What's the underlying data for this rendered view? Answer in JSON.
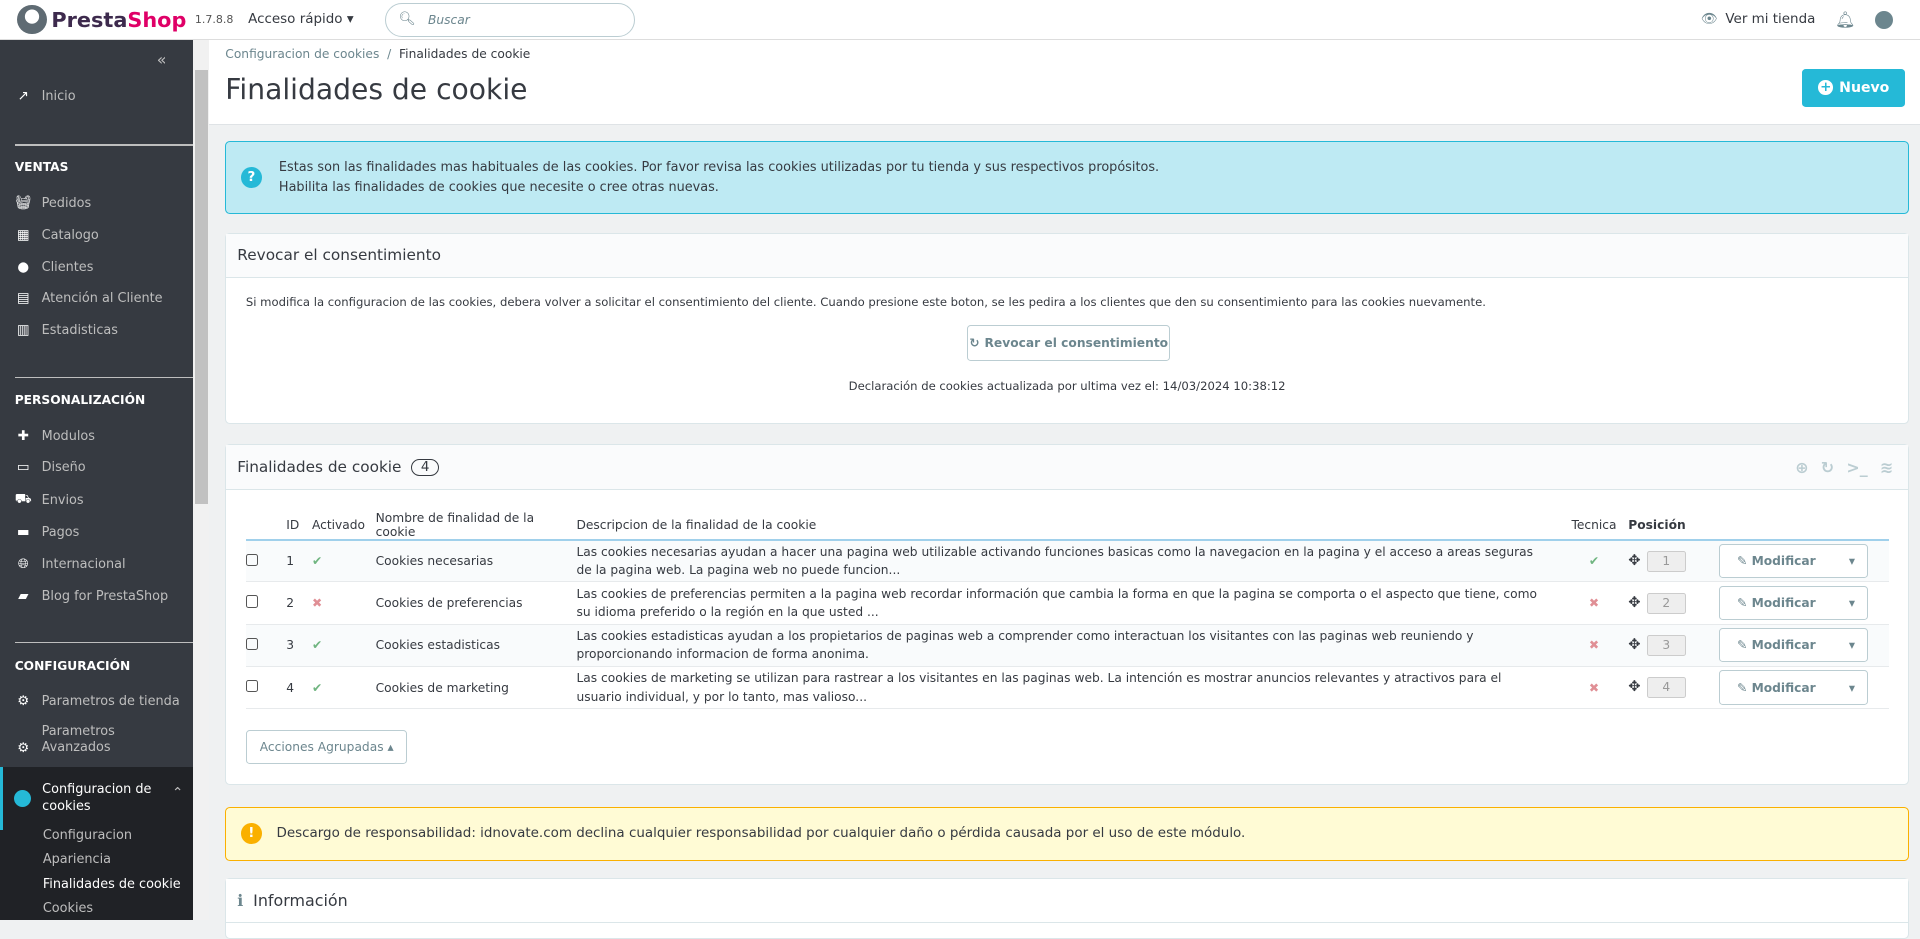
{
  "header": {
    "brand_a": "Presta",
    "brand_b": "Shop",
    "version": "1.7.8.8",
    "quick_access": "Acceso rápido",
    "search_placeholder": "Buscar",
    "view_store": "Ver mi tienda"
  },
  "sidebar": {
    "home": "Inicio",
    "sections": [
      {
        "title": "VENTAS",
        "items": [
          "Pedidos",
          "Catalogo",
          "Clientes",
          "Atención al Cliente",
          "Estadisticas"
        ]
      },
      {
        "title": "PERSONALIZACIÓN",
        "items": [
          "Modulos",
          "Diseño",
          "Envios",
          "Pagos",
          "Internacional",
          "Blog for PrestaShop"
        ]
      },
      {
        "title": "CONFIGURACIÓN",
        "items": [
          "Parametros de tienda",
          "Parametros Avanzados"
        ]
      }
    ],
    "active": "Configuracion de cookies",
    "sub": [
      "Configuracion",
      "Apariencia",
      "Finalidades de cookie",
      "Cookies"
    ]
  },
  "page": {
    "breadcrumb_parent": "Configuracion de cookies",
    "breadcrumb_current": "Finalidades de cookie",
    "title": "Finalidades de cookie",
    "new_button": "Nuevo"
  },
  "info_alert": {
    "line1": "Estas son las finalidades mas habituales de las cookies. Por favor revisa las cookies utilizadas por tu tienda y sus respectivos propósitos.",
    "line2": "Habilita las finalidades de cookies que necesite o cree otras nuevas."
  },
  "revoke": {
    "title": "Revocar el consentimiento",
    "text": "Si modifica la configuracion de las cookies, debera volver a solicitar el consentimiento del cliente. Cuando presione este boton, se les pedira a los clientes que den su consentimiento para las cookies nuevamente.",
    "button": "Revocar el consentimiento",
    "updated": "Declaración de cookies actualizada por ultima vez el: 14/03/2024 10:38:12"
  },
  "list": {
    "title": "Finalidades de cookie",
    "count": "4",
    "columns": {
      "id": "ID",
      "active": "Activado",
      "name": "Nombre de finalidad de la cookie",
      "desc": "Descripcion de la finalidad de la cookie",
      "tech": "Tecnica",
      "pos": "Posición"
    },
    "rows": [
      {
        "id": "1",
        "active": true,
        "name": "Cookies necesarias",
        "desc": "Las cookies necesarias ayudan a hacer una pagina web utilizable activando funciones basicas como la navegacion en la pagina y el acceso a areas seguras de la pagina web. La pagina web no puede funcion...",
        "tech": true,
        "pos": "1",
        "action": "Modificar"
      },
      {
        "id": "2",
        "active": false,
        "name": "Cookies de preferencias",
        "desc": "Las cookies de preferencias permiten a la pagina web recordar información que cambia la forma en que la pagina se comporta o el aspecto que tiene, como su idioma preferido o la región en la que usted ...",
        "tech": false,
        "pos": "2",
        "action": "Modificar"
      },
      {
        "id": "3",
        "active": true,
        "name": "Cookies estadisticas",
        "desc": "Las cookies estadisticas ayudan a los propietarios de paginas web a comprender como interactuan los visitantes con las paginas web reuniendo y proporcionando informacion de forma anonima.",
        "tech": false,
        "pos": "3",
        "action": "Modificar"
      },
      {
        "id": "4",
        "active": true,
        "name": "Cookies de marketing",
        "desc": "Las cookies de marketing se utilizan para rastrear a los visitantes en las paginas web. La intención es mostrar anuncios relevantes y atractivos para el usuario individual, y por lo tanto, mas valioso...",
        "tech": false,
        "pos": "4",
        "action": "Modificar"
      }
    ],
    "bulk": "Acciones Agrupadas"
  },
  "disclaimer": "Descargo de responsabilidad: idnovate.com declina cualquier responsabilidad por cualquier daño o pérdida causada por el uso de este módulo.",
  "info_panel": "Información"
}
